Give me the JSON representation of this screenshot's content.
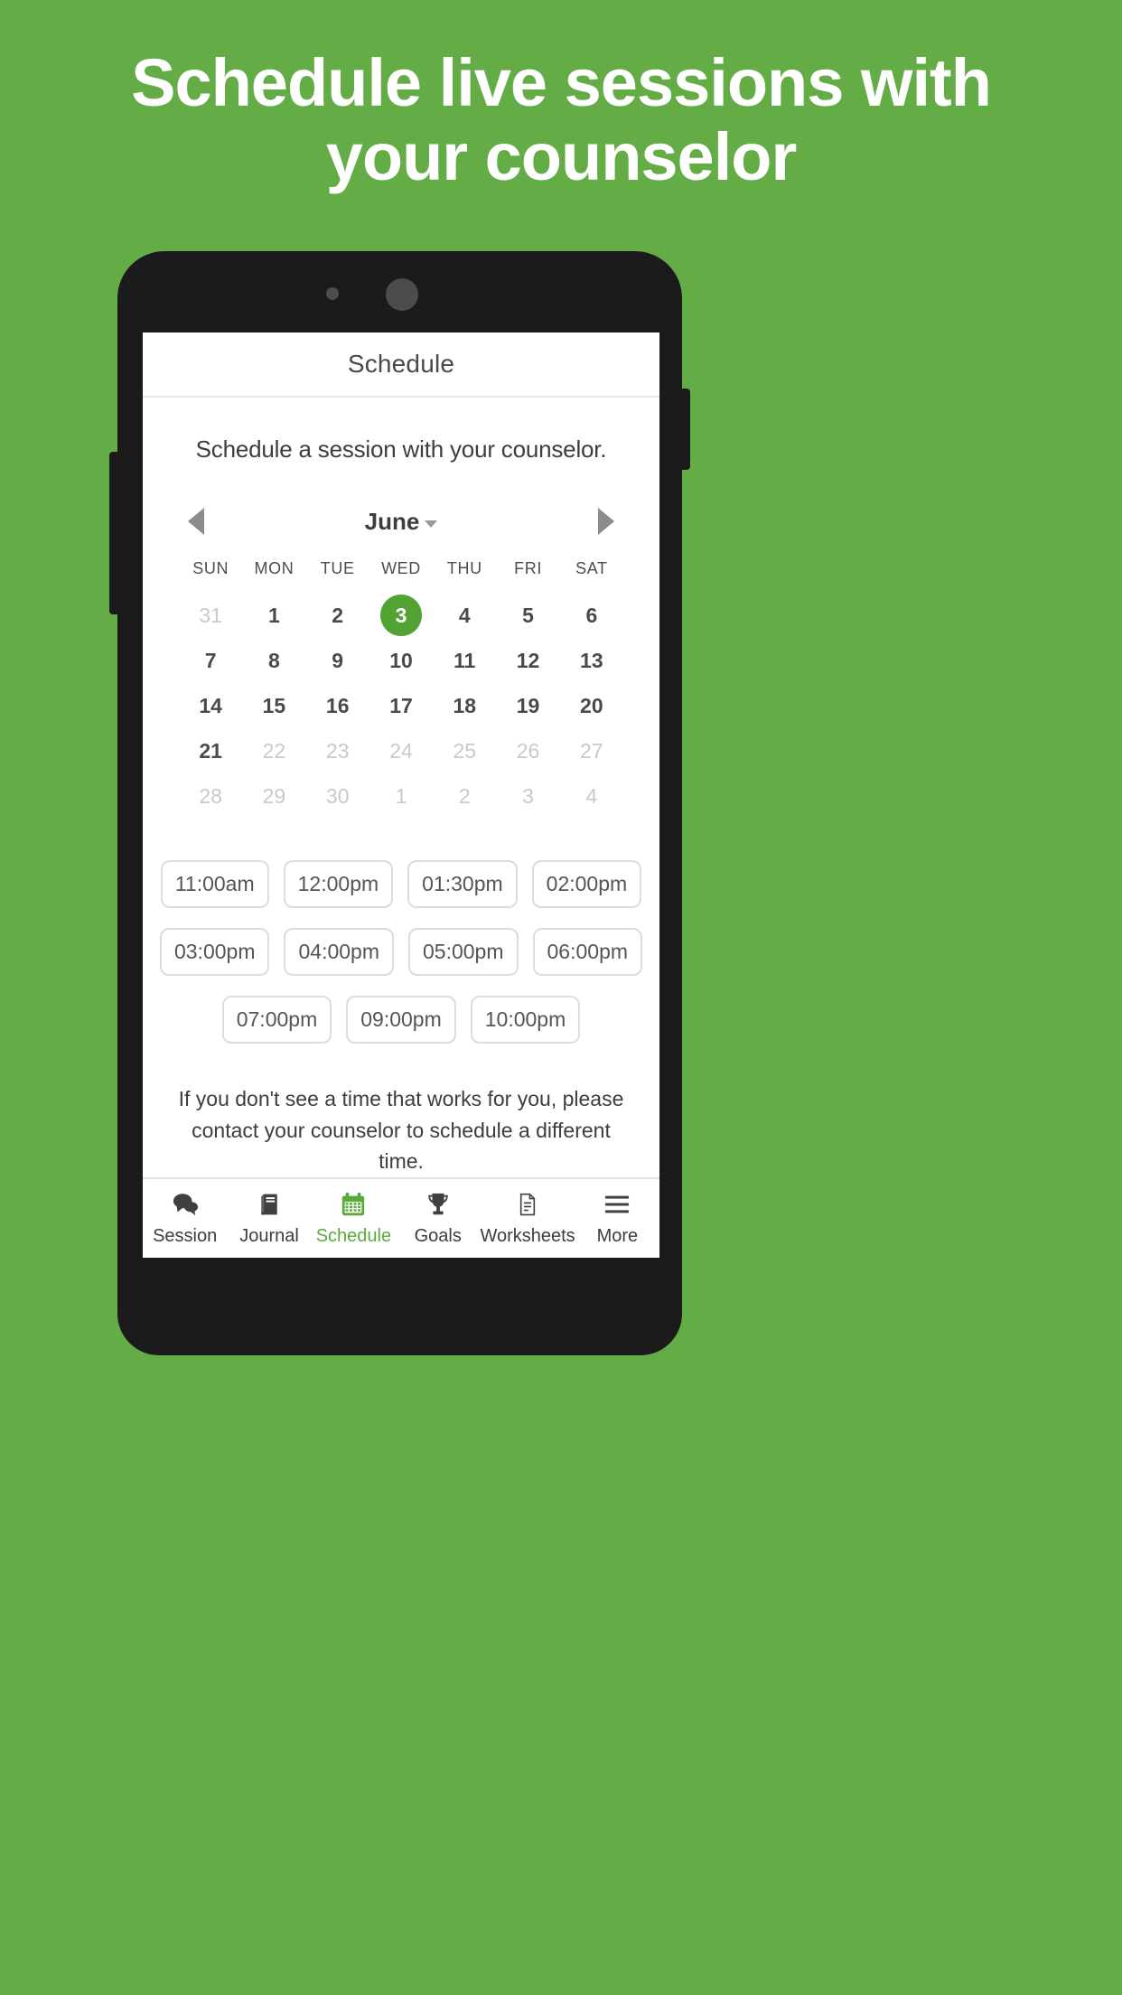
{
  "colors": {
    "background_green": "#64ac46",
    "accent_green": "#52a334",
    "tab_active_green": "#5aab3c",
    "phone_body": "#1b1b1b"
  },
  "headline": {
    "line1": "Schedule live sessions with",
    "line2": "your counselor"
  },
  "app": {
    "appbar": {
      "title": "Schedule"
    },
    "subtitle": "Schedule a session with your counselor.",
    "calendar": {
      "prev_icon": "triangle-left-icon",
      "next_icon": "triangle-right-icon",
      "month": "June",
      "month_caret_icon": "caret-down-icon",
      "weekdays": [
        "SUN",
        "MON",
        "TUE",
        "WED",
        "THU",
        "FRI",
        "SAT"
      ],
      "days": [
        {
          "label": "31",
          "state": "muted"
        },
        {
          "label": "1",
          "state": "normal"
        },
        {
          "label": "2",
          "state": "normal"
        },
        {
          "label": "3",
          "state": "selected"
        },
        {
          "label": "4",
          "state": "normal"
        },
        {
          "label": "5",
          "state": "normal"
        },
        {
          "label": "6",
          "state": "normal"
        },
        {
          "label": "7",
          "state": "normal"
        },
        {
          "label": "8",
          "state": "normal"
        },
        {
          "label": "9",
          "state": "normal"
        },
        {
          "label": "10",
          "state": "normal"
        },
        {
          "label": "11",
          "state": "normal"
        },
        {
          "label": "12",
          "state": "normal"
        },
        {
          "label": "13",
          "state": "normal"
        },
        {
          "label": "14",
          "state": "normal"
        },
        {
          "label": "15",
          "state": "normal"
        },
        {
          "label": "16",
          "state": "normal"
        },
        {
          "label": "17",
          "state": "normal"
        },
        {
          "label": "18",
          "state": "normal"
        },
        {
          "label": "19",
          "state": "normal"
        },
        {
          "label": "20",
          "state": "normal"
        },
        {
          "label": "21",
          "state": "normal"
        },
        {
          "label": "22",
          "state": "muted"
        },
        {
          "label": "23",
          "state": "muted"
        },
        {
          "label": "24",
          "state": "muted"
        },
        {
          "label": "25",
          "state": "muted"
        },
        {
          "label": "26",
          "state": "muted"
        },
        {
          "label": "27",
          "state": "muted"
        },
        {
          "label": "28",
          "state": "muted"
        },
        {
          "label": "29",
          "state": "muted"
        },
        {
          "label": "30",
          "state": "muted"
        },
        {
          "label": "1",
          "state": "muted"
        },
        {
          "label": "2",
          "state": "muted"
        },
        {
          "label": "3",
          "state": "muted"
        },
        {
          "label": "4",
          "state": "muted"
        }
      ]
    },
    "time_slots": [
      [
        "11:00am",
        "12:00pm",
        "01:30pm",
        "02:00pm"
      ],
      [
        "03:00pm",
        "04:00pm",
        "05:00pm",
        "06:00pm"
      ],
      [
        "07:00pm",
        "09:00pm",
        "10:00pm"
      ]
    ],
    "note": "If you don't see a time that works for you, please contact your counselor to schedule a different time.",
    "tabs": [
      {
        "label": "Session",
        "icon": "chat-bubbles-icon",
        "active": false
      },
      {
        "label": "Journal",
        "icon": "book-icon",
        "active": false
      },
      {
        "label": "Schedule",
        "icon": "calendar-icon",
        "active": true
      },
      {
        "label": "Goals",
        "icon": "trophy-icon",
        "active": false
      },
      {
        "label": "Worksheets",
        "icon": "document-icon",
        "active": false
      },
      {
        "label": "More",
        "icon": "hamburger-icon",
        "active": false
      }
    ]
  }
}
